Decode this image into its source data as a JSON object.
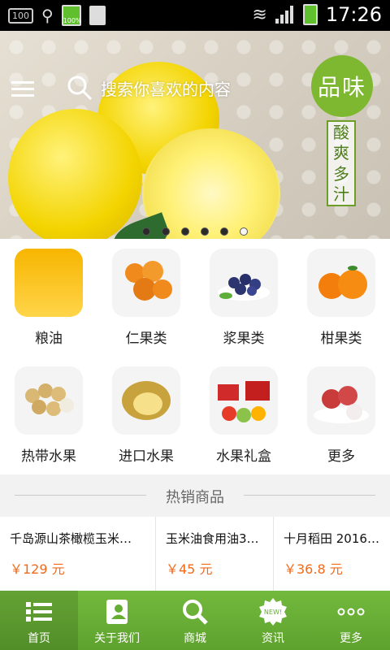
{
  "statusbar": {
    "time": "17:26",
    "box_label": "100",
    "battery_small_label": "100%"
  },
  "banner": {
    "search_placeholder": "搜索你喜欢的内容",
    "badge": "品味",
    "vertical_text": [
      "酸",
      "爽",
      "多",
      "汁"
    ],
    "dots": 6,
    "active_dot": 5
  },
  "categories": [
    {
      "label": "粮油",
      "icon": "grain-oil-icon"
    },
    {
      "label": "仁果类",
      "icon": "loquat-icon"
    },
    {
      "label": "浆果类",
      "icon": "blueberry-icon"
    },
    {
      "label": "柑果类",
      "icon": "orange-icon"
    },
    {
      "label": "热带水果",
      "icon": "longan-icon"
    },
    {
      "label": "进口水果",
      "icon": "durian-icon"
    },
    {
      "label": "水果礼盒",
      "icon": "gift-box-icon"
    },
    {
      "label": "更多",
      "icon": "lychee-icon"
    }
  ],
  "section": {
    "title": "热销商品"
  },
  "products": [
    {
      "name": "千岛源山茶橄榄玉米…",
      "price": "￥129 元"
    },
    {
      "name": "玉米油食用油3…",
      "price": "￥45 元"
    },
    {
      "name": "十月稻田 2016 …",
      "price": "￥36.8 元"
    }
  ],
  "tabs": [
    {
      "label": "首页",
      "icon": "list-icon",
      "active": true
    },
    {
      "label": "关于我们",
      "icon": "contact-card-icon",
      "active": false
    },
    {
      "label": "商城",
      "icon": "search-icon",
      "active": false
    },
    {
      "label": "资讯",
      "icon": "new-badge-icon",
      "active": false
    },
    {
      "label": "更多",
      "icon": "more-dots-icon",
      "active": false
    }
  ],
  "colors": {
    "accent": "#6db336",
    "price": "#f06a1a"
  }
}
